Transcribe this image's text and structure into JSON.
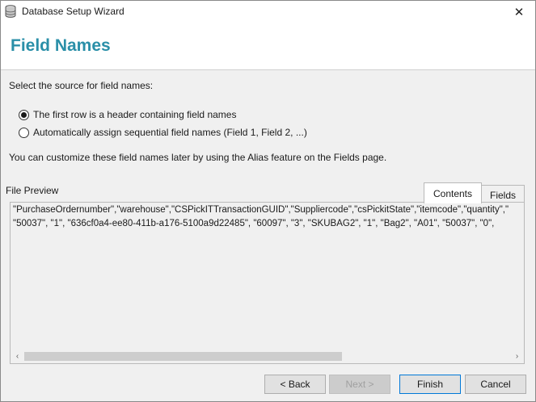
{
  "window": {
    "title": "Database Setup Wizard",
    "close_glyph": "✕",
    "app_icon": "database-icon"
  },
  "header": {
    "title": "Field Names",
    "title_color": "#2a8fa8"
  },
  "main": {
    "source_label": "Select the source for field names:",
    "options": [
      {
        "label": "The first row is a header containing field names",
        "selected": true
      },
      {
        "label": "Automatically assign sequential field names (Field 1, Field 2, ...)",
        "selected": false
      }
    ],
    "hint": "You can customize these field names later by using the Alias feature on the Fields page."
  },
  "preview": {
    "label": "File Preview",
    "tabs": [
      {
        "label": "Contents",
        "active": true
      },
      {
        "label": "Fields",
        "active": false
      }
    ],
    "lines": [
      "\"PurchaseOrdernumber\",\"warehouse\",\"CSPickITTransactionGUID\",\"Suppliercode\",\"csPickitState\",\"itemcode\",\"quantity\",\"Is",
      "\"50037\", \"1\", \"636cf0a4-ee80-411b-a176-5100a9d22485\", \"60097\", \"3\", \"SKUBAG2\", \"1\", \"Bag2\", \"A01\", \"50037\", \"0\","
    ],
    "scroll_left": "‹",
    "scroll_right": "›"
  },
  "footer": {
    "back_label": "< Back",
    "next_label": "Next >",
    "finish_label": "Finish",
    "cancel_label": "Cancel"
  }
}
